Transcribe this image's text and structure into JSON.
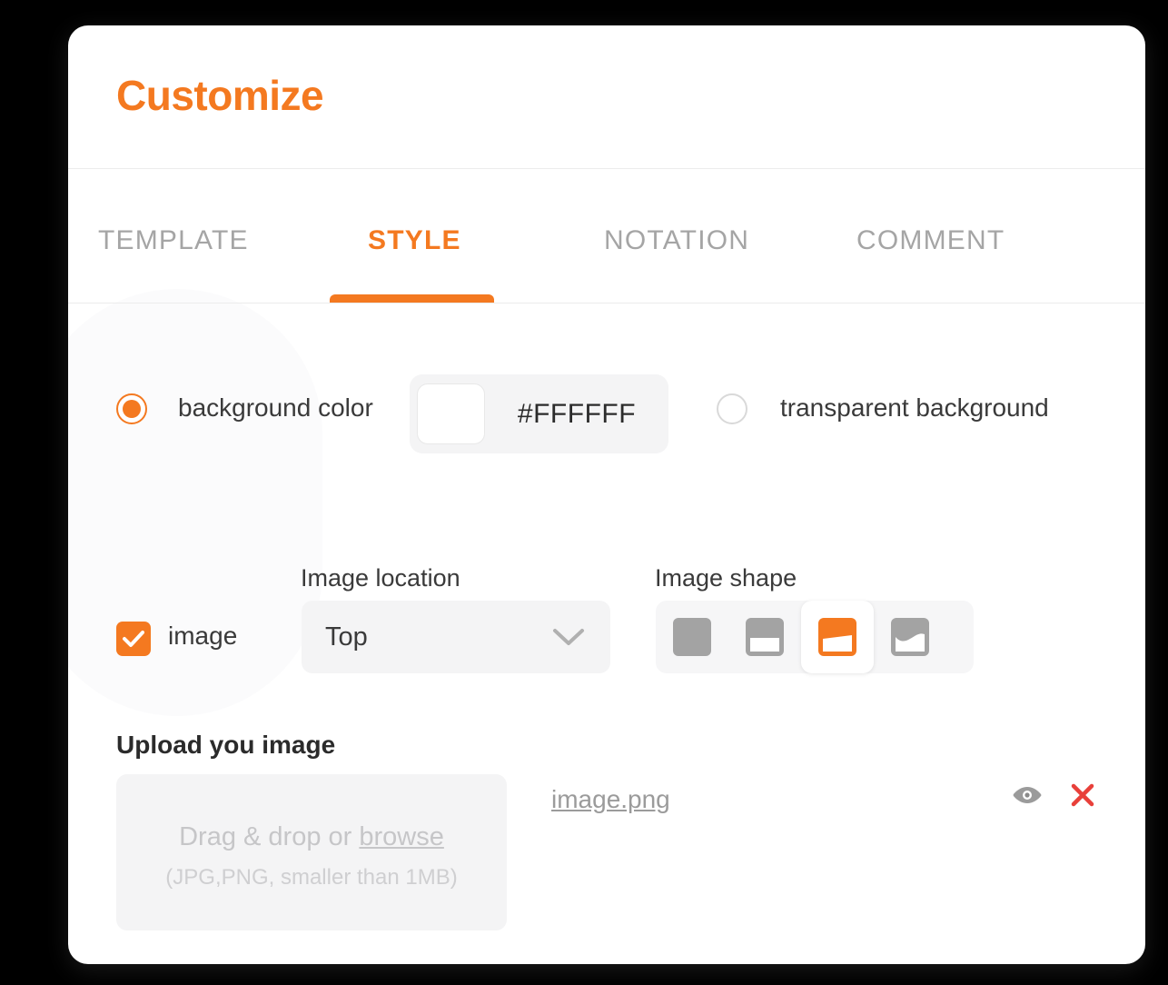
{
  "header": {
    "title": "Customize"
  },
  "tabs": [
    {
      "label": "TEMPLATE",
      "active": false
    },
    {
      "label": "STYLE",
      "active": true
    },
    {
      "label": "NOTATION",
      "active": false
    },
    {
      "label": "COMMENT",
      "active": false
    }
  ],
  "background": {
    "color_option_label": "background color",
    "color_value": "#FFFFFF",
    "swatch_color": "#FFFFFF",
    "transparent_option_label": "transparent background",
    "selected_option": "background color"
  },
  "image_section": {
    "checkbox_label": "image",
    "checkbox_checked": true,
    "location_label": "Image location",
    "location_value": "Top",
    "location_options": [
      "Top"
    ],
    "shape_label": "Image shape",
    "shape_options": [
      {
        "name": "full-square",
        "selected": false
      },
      {
        "name": "straight-cut",
        "selected": false
      },
      {
        "name": "slanted-cut",
        "selected": true
      },
      {
        "name": "wave-cut",
        "selected": false
      }
    ]
  },
  "upload": {
    "heading": "Upload you image",
    "dropzone_text": "Drag & drop or ",
    "dropzone_link": "browse",
    "dropzone_hint": "(JPG,PNG, smaller than 1MB)",
    "file_name": "image.png",
    "preview_icon": "eye-icon",
    "remove_icon": "close-icon"
  },
  "colors": {
    "accent": "#F47920",
    "muted_text": "#a5a5a5",
    "danger": "#E8403A",
    "panel": "#f4f4f5"
  }
}
